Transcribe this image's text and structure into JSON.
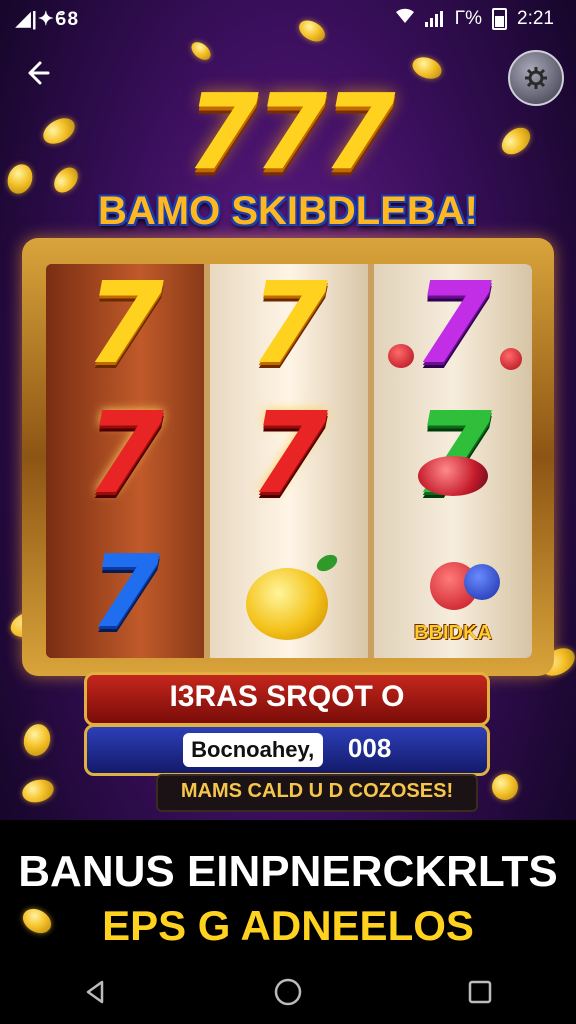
{
  "status_bar": {
    "left_text": "◢|✦ϐ8",
    "time": "2:21",
    "battery_label": "Γ%"
  },
  "header": {
    "title_number": "777",
    "subtitle": "BAMO SKIBDLEBA!"
  },
  "reels": {
    "col1": [
      "7",
      "7",
      "7"
    ],
    "col2": [
      "7",
      "7"
    ],
    "col3": [
      "7",
      "7"
    ],
    "bottom_label": "BBIDKA"
  },
  "banners": {
    "red": "I3RAS SRQOT O",
    "blue_label": "Bocnoahey,",
    "blue_value": "008",
    "dark": "MAMS CALD U D COZOSES!"
  },
  "promo": {
    "headline": "BANUS EINPNERCKRLTS",
    "subhead": "EPS G ADNEELOS"
  },
  "colors": {
    "gold": "#ffd21f",
    "purple_bg": "#3a0f5c",
    "red": "#e82424",
    "blue": "#1f6ef0"
  }
}
